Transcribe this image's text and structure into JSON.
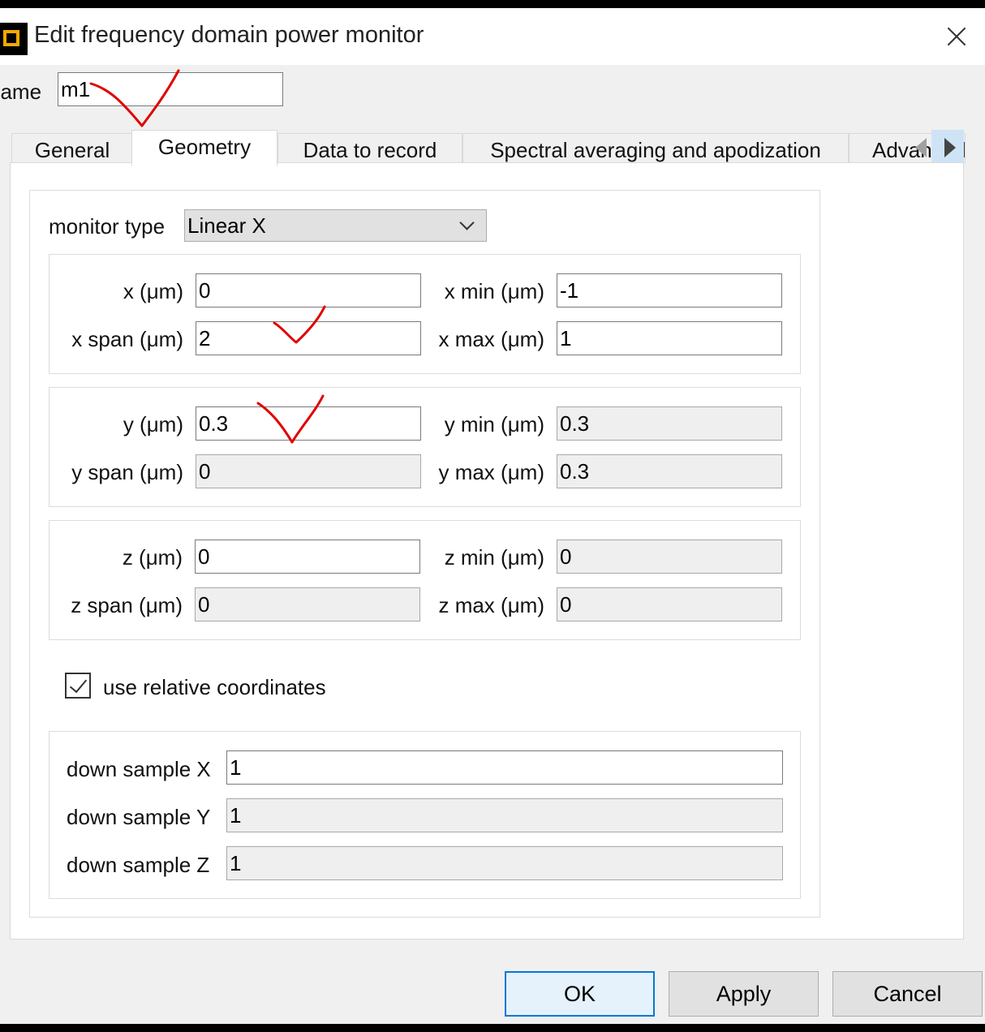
{
  "window": {
    "title": "Edit frequency domain power monitor",
    "app_icon": "monitor-square-icon",
    "close_icon": "close-icon"
  },
  "name_field": {
    "label": "name",
    "value": "m1"
  },
  "tabs": [
    {
      "label": "General",
      "active": false
    },
    {
      "label": "Geometry",
      "active": true
    },
    {
      "label": "Data to record",
      "active": false
    },
    {
      "label": "Spectral averaging and apodization",
      "active": false
    },
    {
      "label": "Advanced",
      "active": false
    }
  ],
  "geometry": {
    "monitor_type": {
      "label": "monitor type",
      "value": "Linear X"
    },
    "x": {
      "center_label": "x (μm)",
      "center_value": "0",
      "span_label": "x span (μm)",
      "span_value": "2",
      "min_label": "x min (μm)",
      "min_value": "-1",
      "max_label": "x max (μm)",
      "max_value": "1"
    },
    "y": {
      "center_label": "y (μm)",
      "center_value": "0.3",
      "span_label": "y span (μm)",
      "span_value": "0",
      "min_label": "y min (μm)",
      "min_value": "0.3",
      "max_label": "y max (μm)",
      "max_value": "0.3"
    },
    "z": {
      "center_label": "z (μm)",
      "center_value": "0",
      "span_label": "z span (μm)",
      "span_value": "0",
      "min_label": "z min (μm)",
      "min_value": "0",
      "max_label": "z max (μm)",
      "max_value": "0"
    },
    "relative_coordinates": {
      "label": "use relative coordinates",
      "checked": true
    },
    "down_sample": {
      "x_label": "down sample X",
      "x_value": "1",
      "y_label": "down sample Y",
      "y_value": "1",
      "z_label": "down sample Z",
      "z_value": "1"
    }
  },
  "buttons": {
    "ok": "OK",
    "apply": "Apply",
    "cancel": "Cancel"
  },
  "annotation_color": "#e00000"
}
